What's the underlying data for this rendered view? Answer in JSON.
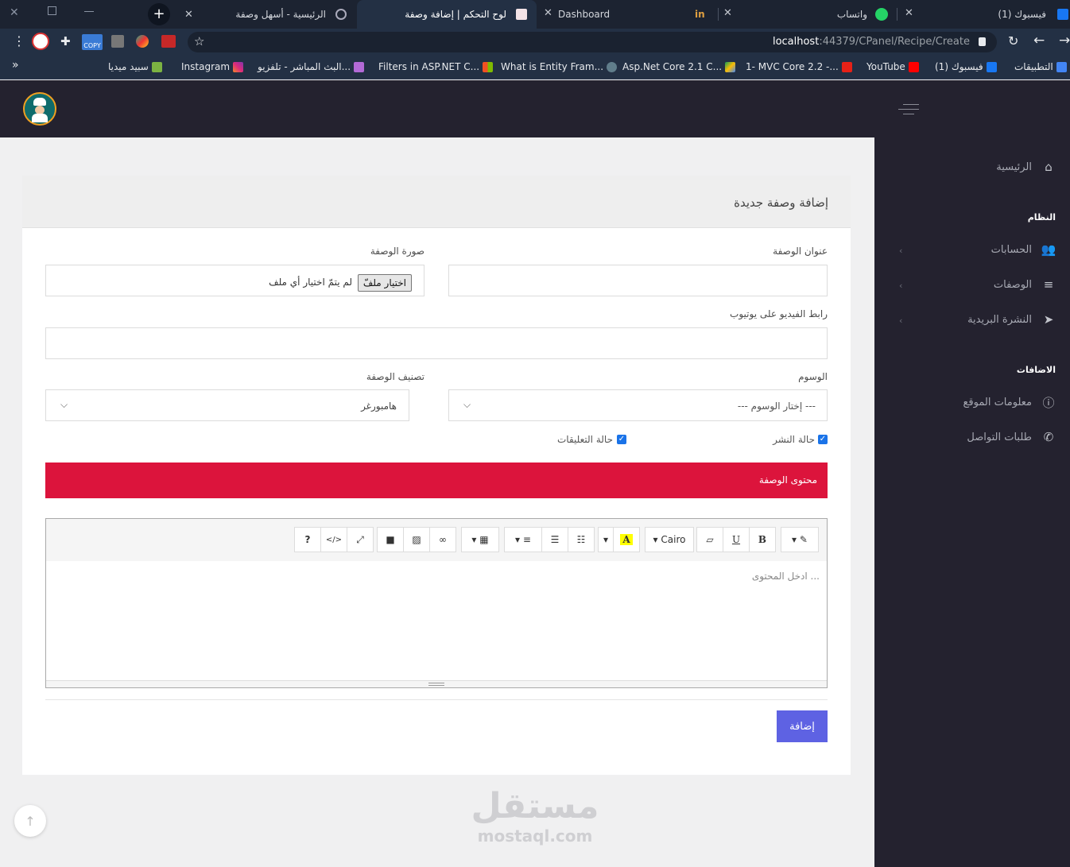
{
  "browser": {
    "tabs": [
      {
        "title": "الرئيسية - أسهل وصفة"
      },
      {
        "title": "لوح التحكم | إضافة وصفة"
      },
      {
        "title": "Dashboard"
      },
      {
        "title": "واتساب"
      },
      {
        "title": "(1) فيسبوك"
      }
    ],
    "url_host": "localhost",
    "url_rest": ":44379/CPanel/Recipe/Create",
    "bookmarks": [
      "التطبيقات",
      "(1) فيسبوك",
      "YouTube",
      "1- MVC Core 2.2 -...",
      "Asp.Net Core 2.1 C...",
      "What is Entity Fram...",
      "Filters in ASP.NET C...",
      "البث المباشر - تلفزيو...",
      "Instagram",
      "سبيد ميديا"
    ],
    "more_bookmarks": "»",
    "copy_ext_label": "COPY"
  },
  "sidebar": {
    "home": "الرئيسية",
    "system_header": "النظام",
    "accounts": "الحسابات",
    "recipes": "الوصفات",
    "newsletter": "النشرة البريدية",
    "additions_header": "الاضافات",
    "site_info": "معلومات الموقع",
    "contact_requests": "طلبات التواصل"
  },
  "form": {
    "title": "إضافة وصفة جديدة",
    "recipe_title_label": "عنوان الوصفة",
    "recipe_image_label": "صورة الوصفة",
    "choose_file": "اختيار ملفّ",
    "no_file": "لم يتمّ اختيار أي ملف",
    "youtube_label": "رابط الفيديو على يوتيوب",
    "tags_label": "الوسوم",
    "tags_placeholder": "--- إختار الوسوم ---",
    "category_label": "تصنيف الوصفة",
    "category_value": "هامبورغر",
    "publish_label": "حالة النشر",
    "comments_label": "حالة التعليقات",
    "content_header": "محتوى الوصفة",
    "editor_placeholder": "ادخل المحتوى ...",
    "font_name": "Cairo",
    "submit": "إضافة"
  },
  "watermark": {
    "arabic": "مستقل",
    "latin": "mostaql.com"
  },
  "colors": {
    "accent_red": "#dc143c",
    "submit_blue": "#5e62e3",
    "sidebar_bg": "#24222f"
  }
}
